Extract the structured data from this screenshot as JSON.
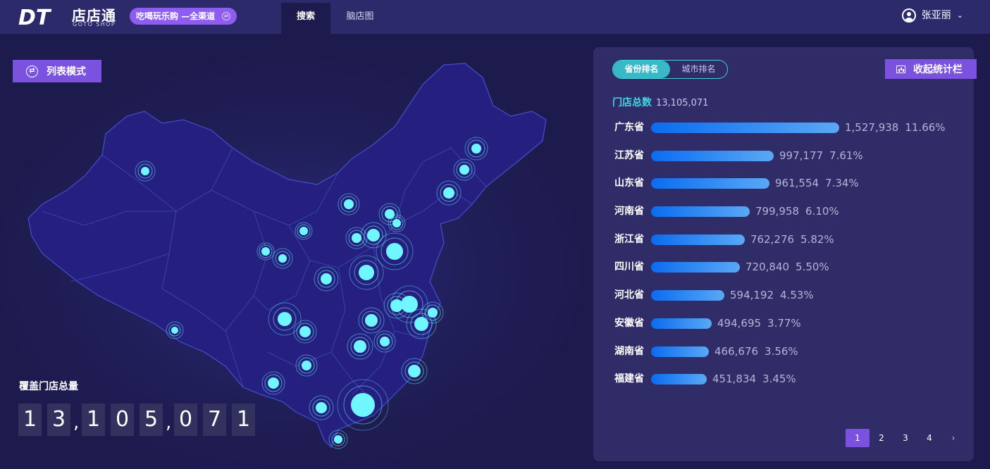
{
  "header": {
    "logo_mark": "DT",
    "logo_text": "店店通",
    "logo_sub": "GOTO SHOP",
    "channel_badge": "吃喝玩乐购 —全渠道",
    "tabs": [
      "搜索",
      "脑店图"
    ],
    "active_tab": "搜索",
    "user_name": "张亚丽"
  },
  "map": {
    "list_mode_label": "列表模式",
    "cover_label": "覆盖门店总量",
    "counter_digits": [
      "1",
      "3",
      ",",
      "1",
      "0",
      "5",
      ",",
      "0",
      "7",
      "1"
    ]
  },
  "panel": {
    "seg_tabs": [
      "省份排名",
      "城市排名"
    ],
    "seg_active": "省份排名",
    "collapse_label": "收起统计栏",
    "total_label": "门店总数",
    "total_value": "13,105,071",
    "ranking": [
      {
        "name": "广东省",
        "value": "1,527,938",
        "pct": "11.66%",
        "num": 1527938
      },
      {
        "name": "江苏省",
        "value": "997,177",
        "pct": "7.61%",
        "num": 997177
      },
      {
        "name": "山东省",
        "value": "961,554",
        "pct": "7.34%",
        "num": 961554
      },
      {
        "name": "河南省",
        "value": "799,958",
        "pct": "6.10%",
        "num": 799958
      },
      {
        "name": "浙江省",
        "value": "762,276",
        "pct": "5.82%",
        "num": 762276
      },
      {
        "name": "四川省",
        "value": "720,840",
        "pct": "5.50%",
        "num": 720840
      },
      {
        "name": "河北省",
        "value": "594,192",
        "pct": "4.53%",
        "num": 594192
      },
      {
        "name": "安徽省",
        "value": "494,695",
        "pct": "3.77%",
        "num": 494695
      },
      {
        "name": "湖南省",
        "value": "466,676",
        "pct": "3.56%",
        "num": 466676
      },
      {
        "name": "福建省",
        "value": "451,834",
        "pct": "3.45%",
        "num": 451834
      }
    ],
    "pages": [
      "1",
      "2",
      "3",
      "4"
    ],
    "current_page": "1",
    "next_icon": "chevron-right-icon"
  },
  "colors": {
    "background": "#1d1b4e",
    "header": "#2c2a6b",
    "panel": "#2f2c68",
    "accent_purple": "#7b52e0",
    "accent_cyan": "#41d9e3",
    "bar_start": "#0a6cf0",
    "bar_end": "#5aa8f5",
    "marker": "#6ff6ff"
  }
}
